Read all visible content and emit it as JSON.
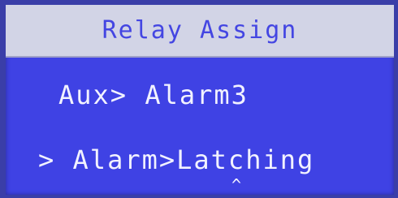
{
  "screen": {
    "title": "Relay Assign",
    "lines": [
      {
        "text": "Aux> Alarm3"
      },
      {
        "text": "> Alarm>Latching"
      }
    ],
    "cursor_glyph": "^"
  },
  "colors": {
    "lcd_background": "#3f42e4",
    "header_background": "#d2d4e6",
    "header_text": "#4446e2",
    "text": "#f2f2ff"
  }
}
